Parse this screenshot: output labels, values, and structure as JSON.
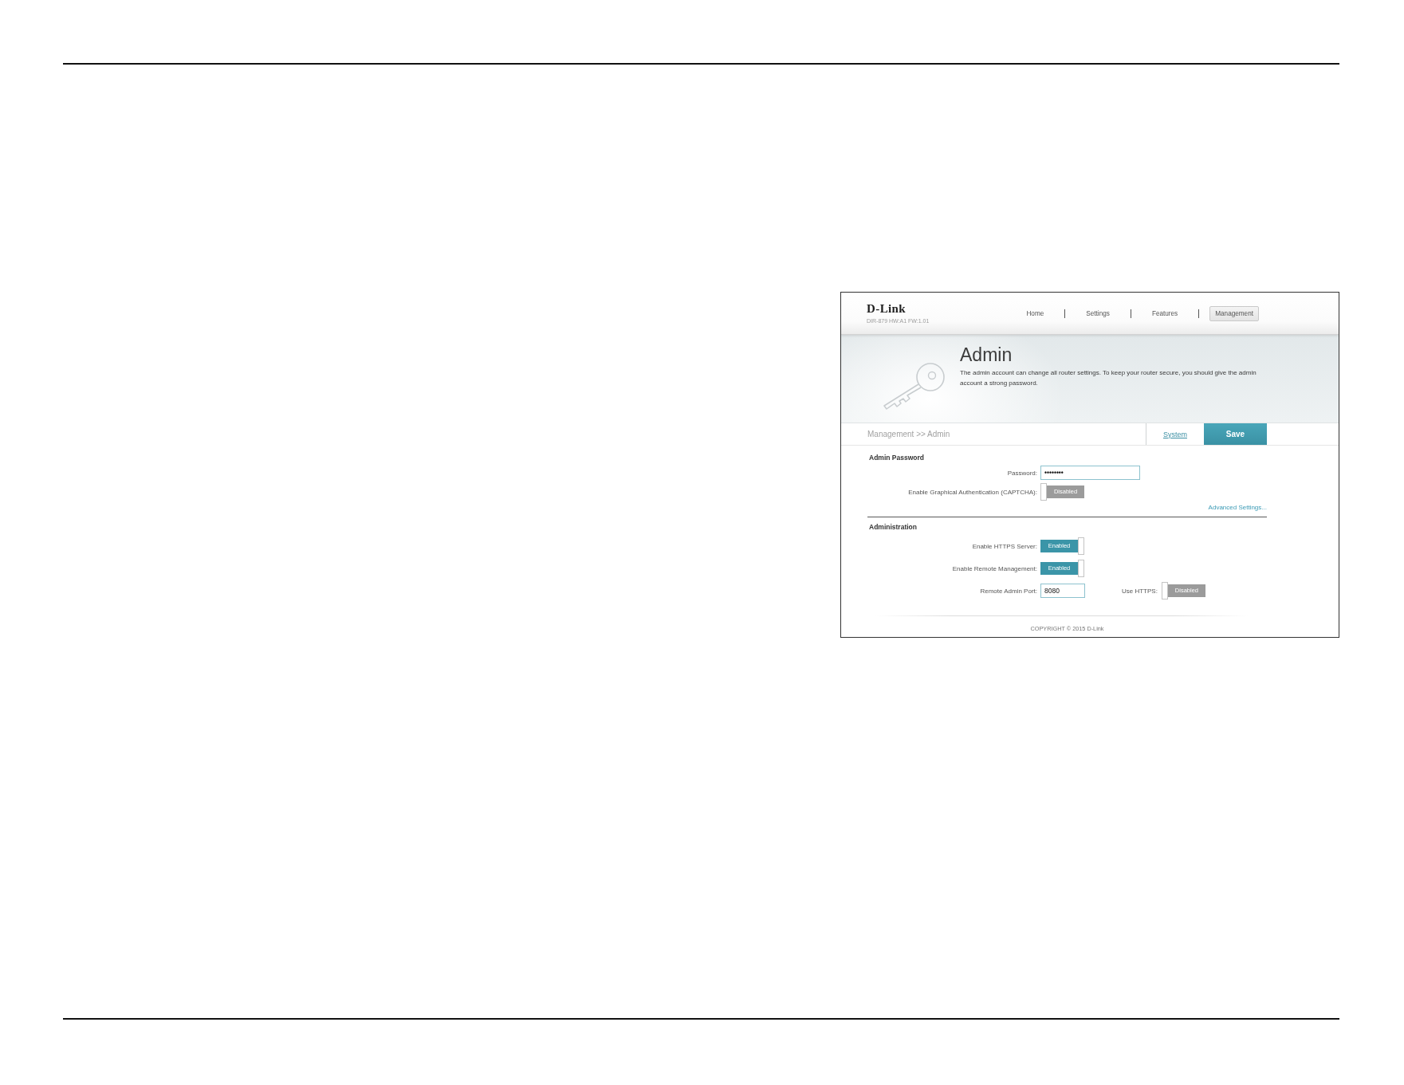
{
  "header": {
    "brand": "D-Link",
    "model": "DIR-879 HW:A1 FW:1.01"
  },
  "nav": [
    {
      "label": "Home",
      "selected": false
    },
    {
      "label": "Settings",
      "selected": false
    },
    {
      "label": "Features",
      "selected": false
    },
    {
      "label": "Management",
      "selected": true
    }
  ],
  "banner": {
    "title": "Admin",
    "description": "The admin account can change all router settings. To keep your router secure, you should give the admin account a strong password."
  },
  "breadcrumb": "Management >> Admin",
  "actions": [
    {
      "label": "System",
      "kind": "link"
    },
    {
      "label": "Save",
      "kind": "primary"
    }
  ],
  "sections": [
    {
      "title": "Admin Password",
      "rows": [
        {
          "kind": "password",
          "label": "Password:",
          "value": "••••••••"
        },
        {
          "kind": "toggle",
          "label": "Enable Graphical Authentication (CAPTCHA):",
          "on": false,
          "text": "Disabled"
        }
      ],
      "link": "Advanced Settings..."
    },
    {
      "title": "Administration",
      "rows": [
        {
          "kind": "toggle",
          "label": "Enable HTTPS Server:",
          "on": true,
          "text": "Enabled"
        },
        {
          "kind": "toggle",
          "label": "Enable Remote Management:",
          "on": true,
          "text": "Enabled"
        },
        {
          "kind": "port",
          "label": "Remote Admin Port:",
          "value": "8080",
          "extra": {
            "label": "Use HTTPS:",
            "on": false,
            "text": "Disabled"
          }
        }
      ]
    }
  ],
  "footer": "COPYRIGHT © 2015 D-Link"
}
